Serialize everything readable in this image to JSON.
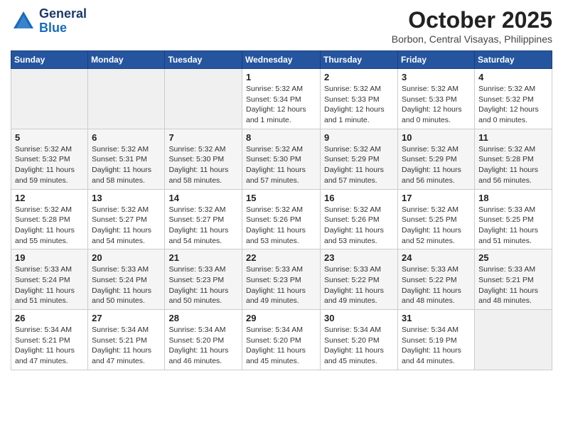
{
  "header": {
    "logo_general": "General",
    "logo_blue": "Blue",
    "month_title": "October 2025",
    "location": "Borbon, Central Visayas, Philippines"
  },
  "days_of_week": [
    "Sunday",
    "Monday",
    "Tuesday",
    "Wednesday",
    "Thursday",
    "Friday",
    "Saturday"
  ],
  "weeks": [
    [
      {
        "day": "",
        "info": ""
      },
      {
        "day": "",
        "info": ""
      },
      {
        "day": "",
        "info": ""
      },
      {
        "day": "1",
        "info": "Sunrise: 5:32 AM\nSunset: 5:34 PM\nDaylight: 12 hours\nand 1 minute."
      },
      {
        "day": "2",
        "info": "Sunrise: 5:32 AM\nSunset: 5:33 PM\nDaylight: 12 hours\nand 1 minute."
      },
      {
        "day": "3",
        "info": "Sunrise: 5:32 AM\nSunset: 5:33 PM\nDaylight: 12 hours\nand 0 minutes."
      },
      {
        "day": "4",
        "info": "Sunrise: 5:32 AM\nSunset: 5:32 PM\nDaylight: 12 hours\nand 0 minutes."
      }
    ],
    [
      {
        "day": "5",
        "info": "Sunrise: 5:32 AM\nSunset: 5:32 PM\nDaylight: 11 hours\nand 59 minutes."
      },
      {
        "day": "6",
        "info": "Sunrise: 5:32 AM\nSunset: 5:31 PM\nDaylight: 11 hours\nand 58 minutes."
      },
      {
        "day": "7",
        "info": "Sunrise: 5:32 AM\nSunset: 5:30 PM\nDaylight: 11 hours\nand 58 minutes."
      },
      {
        "day": "8",
        "info": "Sunrise: 5:32 AM\nSunset: 5:30 PM\nDaylight: 11 hours\nand 57 minutes."
      },
      {
        "day": "9",
        "info": "Sunrise: 5:32 AM\nSunset: 5:29 PM\nDaylight: 11 hours\nand 57 minutes."
      },
      {
        "day": "10",
        "info": "Sunrise: 5:32 AM\nSunset: 5:29 PM\nDaylight: 11 hours\nand 56 minutes."
      },
      {
        "day": "11",
        "info": "Sunrise: 5:32 AM\nSunset: 5:28 PM\nDaylight: 11 hours\nand 56 minutes."
      }
    ],
    [
      {
        "day": "12",
        "info": "Sunrise: 5:32 AM\nSunset: 5:28 PM\nDaylight: 11 hours\nand 55 minutes."
      },
      {
        "day": "13",
        "info": "Sunrise: 5:32 AM\nSunset: 5:27 PM\nDaylight: 11 hours\nand 54 minutes."
      },
      {
        "day": "14",
        "info": "Sunrise: 5:32 AM\nSunset: 5:27 PM\nDaylight: 11 hours\nand 54 minutes."
      },
      {
        "day": "15",
        "info": "Sunrise: 5:32 AM\nSunset: 5:26 PM\nDaylight: 11 hours\nand 53 minutes."
      },
      {
        "day": "16",
        "info": "Sunrise: 5:32 AM\nSunset: 5:26 PM\nDaylight: 11 hours\nand 53 minutes."
      },
      {
        "day": "17",
        "info": "Sunrise: 5:32 AM\nSunset: 5:25 PM\nDaylight: 11 hours\nand 52 minutes."
      },
      {
        "day": "18",
        "info": "Sunrise: 5:33 AM\nSunset: 5:25 PM\nDaylight: 11 hours\nand 51 minutes."
      }
    ],
    [
      {
        "day": "19",
        "info": "Sunrise: 5:33 AM\nSunset: 5:24 PM\nDaylight: 11 hours\nand 51 minutes."
      },
      {
        "day": "20",
        "info": "Sunrise: 5:33 AM\nSunset: 5:24 PM\nDaylight: 11 hours\nand 50 minutes."
      },
      {
        "day": "21",
        "info": "Sunrise: 5:33 AM\nSunset: 5:23 PM\nDaylight: 11 hours\nand 50 minutes."
      },
      {
        "day": "22",
        "info": "Sunrise: 5:33 AM\nSunset: 5:23 PM\nDaylight: 11 hours\nand 49 minutes."
      },
      {
        "day": "23",
        "info": "Sunrise: 5:33 AM\nSunset: 5:22 PM\nDaylight: 11 hours\nand 49 minutes."
      },
      {
        "day": "24",
        "info": "Sunrise: 5:33 AM\nSunset: 5:22 PM\nDaylight: 11 hours\nand 48 minutes."
      },
      {
        "day": "25",
        "info": "Sunrise: 5:33 AM\nSunset: 5:21 PM\nDaylight: 11 hours\nand 48 minutes."
      }
    ],
    [
      {
        "day": "26",
        "info": "Sunrise: 5:34 AM\nSunset: 5:21 PM\nDaylight: 11 hours\nand 47 minutes."
      },
      {
        "day": "27",
        "info": "Sunrise: 5:34 AM\nSunset: 5:21 PM\nDaylight: 11 hours\nand 47 minutes."
      },
      {
        "day": "28",
        "info": "Sunrise: 5:34 AM\nSunset: 5:20 PM\nDaylight: 11 hours\nand 46 minutes."
      },
      {
        "day": "29",
        "info": "Sunrise: 5:34 AM\nSunset: 5:20 PM\nDaylight: 11 hours\nand 45 minutes."
      },
      {
        "day": "30",
        "info": "Sunrise: 5:34 AM\nSunset: 5:20 PM\nDaylight: 11 hours\nand 45 minutes."
      },
      {
        "day": "31",
        "info": "Sunrise: 5:34 AM\nSunset: 5:19 PM\nDaylight: 11 hours\nand 44 minutes."
      },
      {
        "day": "",
        "info": ""
      }
    ]
  ]
}
